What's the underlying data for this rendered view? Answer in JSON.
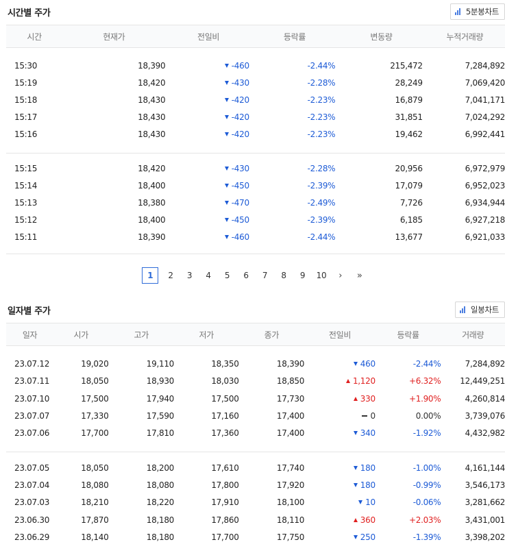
{
  "time_section": {
    "title": "시간별 주가",
    "chart_button": "5분봉차트",
    "headers": [
      "시간",
      "현재가",
      "전일비",
      "등락률",
      "변동량",
      "누적거래량"
    ],
    "group1": [
      {
        "time": "15:30",
        "price": "18,390",
        "change": "460",
        "rate": "-2.44%",
        "vol": "215,472",
        "acc": "7,284,892"
      },
      {
        "time": "15:19",
        "price": "18,420",
        "change": "430",
        "rate": "-2.28%",
        "vol": "28,249",
        "acc": "7,069,420"
      },
      {
        "time": "15:18",
        "price": "18,430",
        "change": "420",
        "rate": "-2.23%",
        "vol": "16,879",
        "acc": "7,041,171"
      },
      {
        "time": "15:17",
        "price": "18,430",
        "change": "420",
        "rate": "-2.23%",
        "vol": "31,851",
        "acc": "7,024,292"
      },
      {
        "time": "15:16",
        "price": "18,430",
        "change": "420",
        "rate": "-2.23%",
        "vol": "19,462",
        "acc": "6,992,441"
      }
    ],
    "group2": [
      {
        "time": "15:15",
        "price": "18,420",
        "change": "430",
        "rate": "-2.28%",
        "vol": "20,956",
        "acc": "6,972,979"
      },
      {
        "time": "15:14",
        "price": "18,400",
        "change": "450",
        "rate": "-2.39%",
        "vol": "17,079",
        "acc": "6,952,023"
      },
      {
        "time": "15:13",
        "price": "18,380",
        "change": "470",
        "rate": "-2.49%",
        "vol": "7,726",
        "acc": "6,934,944"
      },
      {
        "time": "15:12",
        "price": "18,400",
        "change": "450",
        "rate": "-2.39%",
        "vol": "6,185",
        "acc": "6,927,218"
      },
      {
        "time": "15:11",
        "price": "18,390",
        "change": "460",
        "rate": "-2.44%",
        "vol": "13,677",
        "acc": "6,921,033"
      }
    ]
  },
  "pagination": {
    "pages": [
      "1",
      "2",
      "3",
      "4",
      "5",
      "6",
      "7",
      "8",
      "9",
      "10"
    ],
    "current": "1",
    "next": "›",
    "last": "»"
  },
  "daily_section": {
    "title": "일자별 주가",
    "chart_button": "일봉차트",
    "headers": [
      "일자",
      "시가",
      "고가",
      "저가",
      "종가",
      "전일비",
      "등락률",
      "거래량"
    ],
    "group1": [
      {
        "date": "23.07.12",
        "open": "19,020",
        "high": "19,110",
        "low": "18,350",
        "close": "18,390",
        "dir": "down",
        "change": "460",
        "rate": "-2.44%",
        "vol": "7,284,892"
      },
      {
        "date": "23.07.11",
        "open": "18,050",
        "high": "18,930",
        "low": "18,030",
        "close": "18,850",
        "dir": "up",
        "change": "1,120",
        "rate": "+6.32%",
        "vol": "12,449,251"
      },
      {
        "date": "23.07.10",
        "open": "17,500",
        "high": "17,940",
        "low": "17,500",
        "close": "17,730",
        "dir": "up",
        "change": "330",
        "rate": "+1.90%",
        "vol": "4,260,814"
      },
      {
        "date": "23.07.07",
        "open": "17,330",
        "high": "17,590",
        "low": "17,160",
        "close": "17,400",
        "dir": "flat",
        "change": "0",
        "rate": "0.00%",
        "vol": "3,739,076"
      },
      {
        "date": "23.07.06",
        "open": "17,700",
        "high": "17,810",
        "low": "17,360",
        "close": "17,400",
        "dir": "down",
        "change": "340",
        "rate": "-1.92%",
        "vol": "4,432,982"
      }
    ],
    "group2": [
      {
        "date": "23.07.05",
        "open": "18,050",
        "high": "18,200",
        "low": "17,610",
        "close": "17,740",
        "dir": "down",
        "change": "180",
        "rate": "-1.00%",
        "vol": "4,161,144"
      },
      {
        "date": "23.07.04",
        "open": "18,080",
        "high": "18,080",
        "low": "17,800",
        "close": "17,920",
        "dir": "down",
        "change": "180",
        "rate": "-0.99%",
        "vol": "3,546,173"
      },
      {
        "date": "23.07.03",
        "open": "18,210",
        "high": "18,220",
        "low": "17,910",
        "close": "18,100",
        "dir": "down",
        "change": "10",
        "rate": "-0.06%",
        "vol": "3,281,662"
      },
      {
        "date": "23.06.30",
        "open": "17,870",
        "high": "18,180",
        "low": "17,860",
        "close": "18,110",
        "dir": "up",
        "change": "360",
        "rate": "+2.03%",
        "vol": "3,431,001"
      },
      {
        "date": "23.06.29",
        "open": "18,140",
        "high": "18,180",
        "low": "17,700",
        "close": "17,750",
        "dir": "down",
        "change": "250",
        "rate": "-1.39%",
        "vol": "3,398,202"
      }
    ]
  },
  "colors": {
    "up": "#e02020",
    "down": "#1d5bd6",
    "flat": "#333333",
    "accent": "#2e6bd8"
  },
  "icons": {
    "chart_button": "bar-chart-icon",
    "down": "triangle-down-icon",
    "up": "triangle-up-icon",
    "flat": "dash-icon"
  }
}
